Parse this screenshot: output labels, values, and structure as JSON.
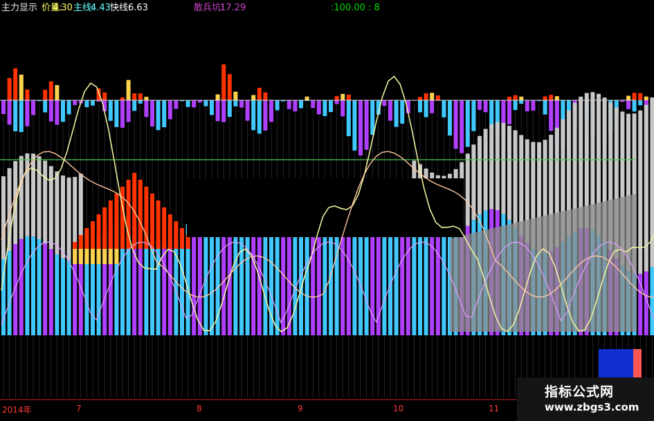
{
  "header": {
    "indicator_name": "主力显示",
    "price_label": "价量:",
    "price_value": "4.30",
    "main_label": "主线:",
    "main_value": "4.43",
    "fast_label": "快线:",
    "fast_value": "6.63",
    "retail_label": "散兵坑:",
    "retail_value": "17.29",
    "ref_value": ":100.00 : 8"
  },
  "time_axis": {
    "labels": [
      "2014年",
      "7",
      "8",
      "9",
      "10",
      "11"
    ]
  },
  "watermark": {
    "line1": "指标公式网",
    "line2": "www.zbgs3.com"
  },
  "colors": {
    "header_name": "#e8e8e8",
    "price": "#ffff66",
    "main": "#66ffff",
    "fast": "#ffffff",
    "retail": "#cc44cc",
    "ref": "#00dd00",
    "red_bar": "#ff3300",
    "yellow_bar": "#ffd24d",
    "purple_bar": "#b040ff",
    "cyan_bar": "#40c8ff",
    "gray_bar": "#c8c8c8",
    "ref_line": "#50c850"
  },
  "chart_data": {
    "type": "bar",
    "title": "",
    "xlabel": "",
    "ylabel": "",
    "x_labels": [
      "2014年",
      "7",
      "8",
      "9",
      "10",
      "11"
    ],
    "series": [
      {
        "name": "价量",
        "last": 4.3
      },
      {
        "name": "主线",
        "last": 4.43
      },
      {
        "name": "快线",
        "last": 6.63
      },
      {
        "name": "散兵坑",
        "last": 17.29
      }
    ],
    "reference_level": 100.0,
    "grid": false,
    "legend": "top"
  }
}
